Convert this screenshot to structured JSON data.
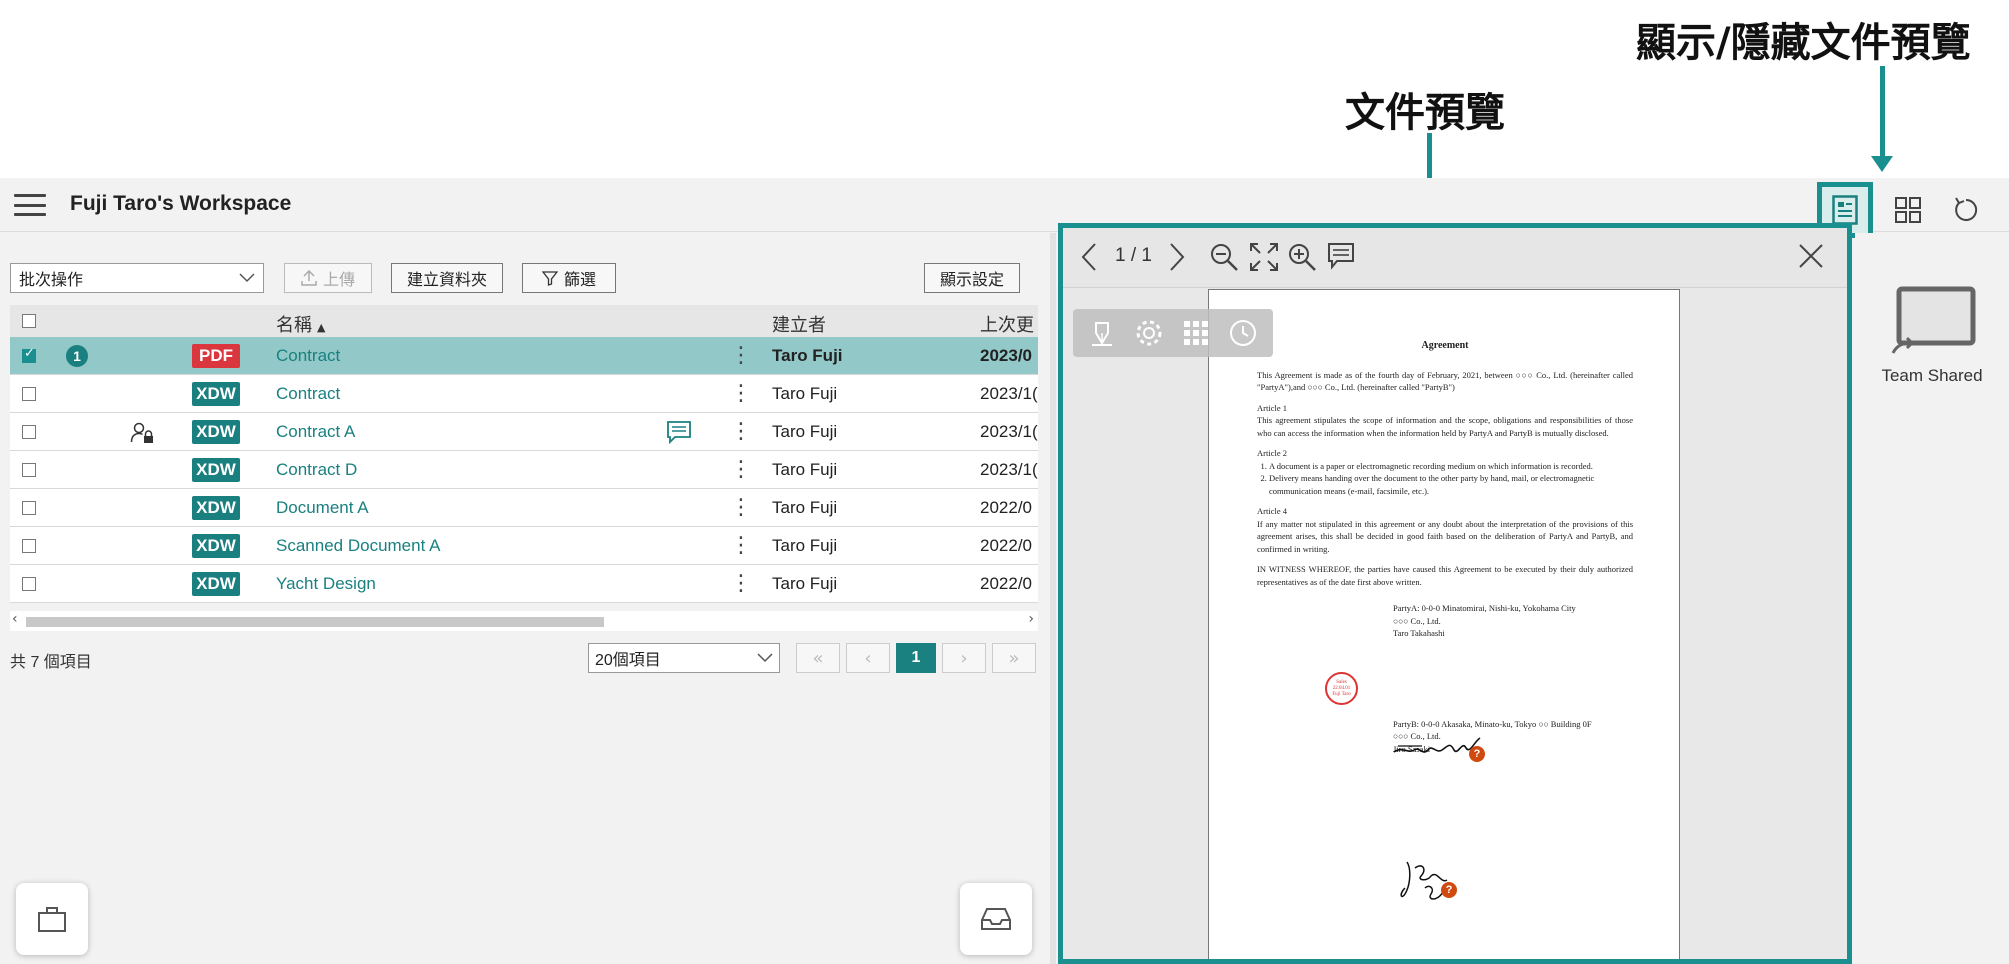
{
  "annotations": {
    "toggle_preview": "顯示/隱藏文件預覽",
    "document_preview": "文件預覽"
  },
  "header": {
    "workspace_title": "Fuji Taro's Workspace",
    "icons": [
      "menu-icon",
      "document-preview-icon",
      "grid-view-icon",
      "refresh-icon"
    ]
  },
  "toolbar": {
    "batch_select": "批次操作",
    "upload": "上傳",
    "create_folder": "建立資料夾",
    "filter": "篩選",
    "display_settings": "顯示設定"
  },
  "table": {
    "columns": {
      "name": "名稱",
      "sort_indicator": "▲",
      "creator": "建立者",
      "updated": "上次更"
    },
    "rows": [
      {
        "type": "PDF",
        "name": "Contract",
        "creator": "Taro Fuji",
        "updated": "2023/0",
        "checked": true,
        "badge": "1"
      },
      {
        "type": "XDW",
        "name": "Contract",
        "creator": "Taro Fuji",
        "updated": "2023/1("
      },
      {
        "type": "XDW",
        "name": "Contract A",
        "creator": "Taro Fuji",
        "updated": "2023/1("
      },
      {
        "type": "XDW",
        "name": "Contract D",
        "creator": "Taro Fuji",
        "updated": "2023/1("
      },
      {
        "type": "XDW",
        "name": "Document A",
        "creator": "Taro Fuji",
        "updated": "2022/0"
      },
      {
        "type": "XDW",
        "name": "Scanned Document A",
        "creator": "Taro Fuji",
        "updated": "2022/0"
      },
      {
        "type": "XDW",
        "name": "Yacht Design",
        "creator": "Taro Fuji",
        "updated": "2022/0"
      }
    ]
  },
  "footer": {
    "total": "共 7 個項目",
    "page_size": "20個項目",
    "current_page": "1"
  },
  "preview": {
    "page_indicator": "1 / 1",
    "document": {
      "title": "Agreement",
      "intro": "This Agreement is made as of the fourth day of February, 2021, between ○○○ Co., Ltd. (hereinafter called \"PartyA\"),and ○○○ Co., Ltd. (hereinafter called \"PartyB\")",
      "article1_title": "Article 1",
      "article1": "This agreement stipulates the scope of information and the scope, obligations and responsibilities of those who can access the information when the information held by PartyA and PartyB is mutually disclosed.",
      "article2_title": "Article 2",
      "article2_item1": "A document is a paper or electromagnetic recording medium on which information is recorded.",
      "article2_item2": "Delivery means handing over the document to the other party by hand, mail, or electromagnetic communication means (e-mail, facsimile, etc.).",
      "article4_title": "Article 4",
      "article4": "If any matter not stipulated in this agreement or any doubt about the interpretation of the provisions of this agreement arises, this shall be decided in good faith based on the deliberation of PartyA and PartyB, and confirmed in writing.",
      "witness": "IN WITNESS WHEREOF, the parties have caused this Agreement to be executed by their duly authorized representatives as of the date first above written.",
      "partyA_line1": "PartyA: 0-0-0 Minatomirai, Nishi-ku, Yokohama City",
      "partyA_line2": "○○○ Co., Ltd.",
      "partyA_line3": "Taro Takahashi",
      "partyB_line1": "PartyB: 0-0-0 Akasaka, Minato-ku, Tokyo ○○ Building 0F",
      "partyB_line2": "○○○ Co., Ltd.",
      "partyB_line3": "Jiro Sasaki",
      "seal_line1": "Sales",
      "seal_line2": "22.04.01",
      "seal_line3": "Fuji Taro",
      "verify_mark": "?"
    }
  },
  "rail": {
    "team_shared": "Team Shared"
  },
  "colors": {
    "accent": "#1a8f8f",
    "pdf_badge": "#d9363e",
    "xdw_badge": "#1a7f7f",
    "selected_row": "#92c8c8"
  }
}
